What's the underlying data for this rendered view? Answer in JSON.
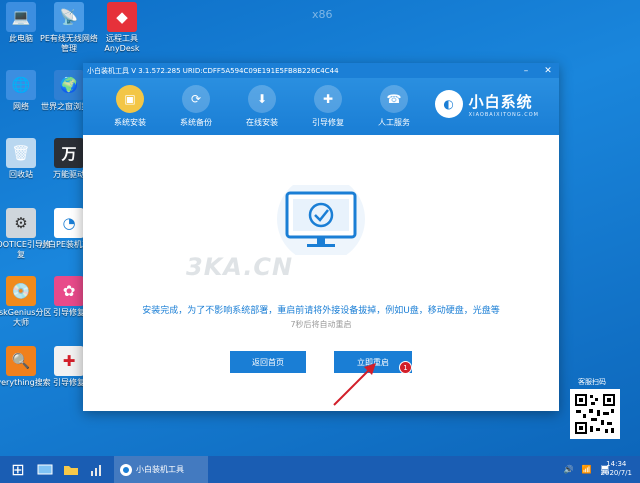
{
  "desktop": {
    "top_text": "x86",
    "icons": [
      {
        "label": "此电脑",
        "glyph": "💻"
      },
      {
        "label": "PE有线无线网络管理",
        "glyph": "📡"
      },
      {
        "label": "远程工具AnyDesk",
        "glyph": "◆"
      },
      {
        "label": "网络",
        "glyph": "🌐"
      },
      {
        "label": "世界之窗浏览器",
        "glyph": "🌍"
      },
      {
        "label": "回收站",
        "glyph": "🗑"
      },
      {
        "label": "万能驱动",
        "glyph": "万"
      },
      {
        "label": "BOOTICE引导修复",
        "glyph": "⚙"
      },
      {
        "label": "小白PE装机工具",
        "glyph": "◔"
      },
      {
        "label": "DiskGenius分区大师",
        "glyph": "💿"
      },
      {
        "label": "引导修复",
        "glyph": "✿"
      },
      {
        "label": "Everything搜索",
        "glyph": "🔍"
      },
      {
        "label": "引导修复",
        "glyph": "✚"
      }
    ]
  },
  "window": {
    "title": "小白装机工具 V 3.1.572.285 URID:CDFF5A594C09E191E5FB8B226C4C44",
    "minimize": "–",
    "close": "✕",
    "nav": [
      {
        "label": "系统安装",
        "glyph": "▣"
      },
      {
        "label": "系统备份",
        "glyph": "⟳"
      },
      {
        "label": "在线安装",
        "glyph": "⬇"
      },
      {
        "label": "引导修复",
        "glyph": "✚"
      },
      {
        "label": "人工服务",
        "glyph": "☎"
      }
    ],
    "brand_name": "小白系统",
    "brand_sub": "XIAOBAIXITONG.COM",
    "brand_logo": "◐",
    "watermark": "3KA.CN",
    "message": "安装完成，为了不影响系统部署，重启前请将外接设备拔掉，例如U盘，移动硬盘，光盘等",
    "countdown": "7秒后将自动重启",
    "btn_home": "返回首页",
    "btn_restart": "立即重启",
    "badge": "1"
  },
  "qr_label": "客服扫码",
  "taskbar": {
    "start": "⊞",
    "task_label": "小白装机工具",
    "tray": [
      "🔊",
      "📶",
      "🖥"
    ],
    "time": "14:34",
    "date": "2020/7/1"
  },
  "colors": {
    "accent": "#1a7ed5",
    "active_nav": "#f3c646",
    "badge": "#d21f2a"
  }
}
